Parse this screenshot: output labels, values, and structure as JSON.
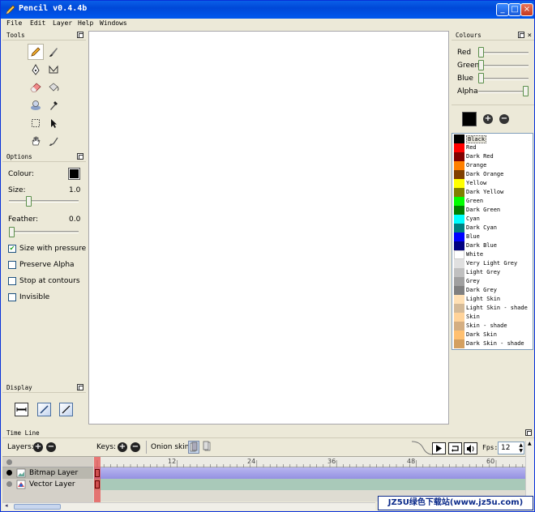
{
  "window": {
    "title": "Pencil v0.4.4b",
    "minimize": "_",
    "maximize": "□",
    "close": "×"
  },
  "menu": [
    "File",
    "Edit",
    "Layer",
    "Help",
    "Windows"
  ],
  "tools": {
    "title": "Tools"
  },
  "options": {
    "title": "Options",
    "colour_label": "Colour:",
    "colour_value": "#000000",
    "size_label": "Size:",
    "size_value": "1.0",
    "size_level": 0.25,
    "feather_label": "Feather:",
    "feather_value": "0.0",
    "feather_level": 0.0,
    "checks": [
      {
        "label": "Size with pressure",
        "checked": true,
        "mark": "✔"
      },
      {
        "label": "Preserve Alpha",
        "checked": false,
        "mark": ""
      },
      {
        "label": "Stop at contours",
        "checked": false,
        "mark": ""
      },
      {
        "label": "Invisible",
        "checked": false,
        "mark": ""
      }
    ]
  },
  "display": {
    "title": "Display"
  },
  "colours": {
    "title": "Colours",
    "sliders": [
      {
        "label": "Red",
        "level": 0.0
      },
      {
        "label": "Green",
        "level": 0.0
      },
      {
        "label": "Blue",
        "level": 0.0
      },
      {
        "label": "Alpha",
        "level": 1.0
      }
    ],
    "current": "#000000",
    "list": [
      {
        "name": "Black",
        "hex": "#000000",
        "selected": true
      },
      {
        "name": "Red",
        "hex": "#ff0000"
      },
      {
        "name": "Dark Red",
        "hex": "#800000"
      },
      {
        "name": "Orange",
        "hex": "#ff8000"
      },
      {
        "name": "Dark Orange",
        "hex": "#804000"
      },
      {
        "name": "Yellow",
        "hex": "#ffff00"
      },
      {
        "name": "Dark Yellow",
        "hex": "#808000"
      },
      {
        "name": "Green",
        "hex": "#00ff00"
      },
      {
        "name": "Dark Green",
        "hex": "#008000"
      },
      {
        "name": "Cyan",
        "hex": "#00ffff"
      },
      {
        "name": "Dark Cyan",
        "hex": "#008080"
      },
      {
        "name": "Blue",
        "hex": "#0000ff"
      },
      {
        "name": "Dark Blue",
        "hex": "#000080"
      },
      {
        "name": "White",
        "hex": "#ffffff"
      },
      {
        "name": "Very Light Grey",
        "hex": "#e0e0e0"
      },
      {
        "name": "Light Grey",
        "hex": "#c0c0c0"
      },
      {
        "name": "Grey",
        "hex": "#a0a0a0"
      },
      {
        "name": "Dark Grey",
        "hex": "#808080"
      },
      {
        "name": "Light Skin",
        "hex": "#ffe0b4"
      },
      {
        "name": "Light Skin - shade",
        "hex": "#d4ba98"
      },
      {
        "name": "Skin",
        "hex": "#ffd39a"
      },
      {
        "name": "Skin - shade",
        "hex": "#d4ae82"
      },
      {
        "name": "Dark Skin",
        "hex": "#ffc070"
      },
      {
        "name": "Dark Skin - shade",
        "hex": "#d4a060"
      }
    ]
  },
  "timeline": {
    "title": "Time Line",
    "layers_label": "Layers:",
    "keys_label": "Keys:",
    "onion_label": "Onion skin:",
    "fps_label": "Fps:",
    "fps_value": "12",
    "ruler": [
      "12",
      "24",
      "36",
      "48",
      "60"
    ],
    "layers": [
      {
        "name": "Bitmap Layer",
        "type": "bitmap"
      },
      {
        "name": "Vector Layer",
        "type": "vector"
      }
    ]
  },
  "watermark": "JZ5U绿色下载站(www.jz5u.com)"
}
